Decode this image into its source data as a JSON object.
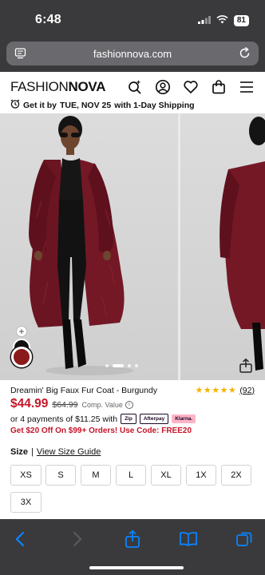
{
  "status": {
    "time": "6:48",
    "battery": "81"
  },
  "browser": {
    "url": "fashionnova.com"
  },
  "header": {
    "logo_part1": "FASHION",
    "logo_part2": "NOVA",
    "shipping_prefix": "Get it by",
    "shipping_date": "TUE, NOV 25",
    "shipping_suffix": "with 1-Day Shipping"
  },
  "gallery": {
    "swatch_add": "+",
    "active_slide": 2,
    "slide_count": 4
  },
  "product": {
    "title": "Dreamin' Big Faux Fur Coat - Burgundy",
    "stars": "★★★★★",
    "review_count": "(92)",
    "price": "$44.99",
    "compare_price": "$64.99",
    "compare_label": "Comp. Value",
    "payments_text": "or 4 payments of $11.25 with",
    "pay_badges": [
      "Zip",
      "Afterpay",
      "Klarna."
    ],
    "promo": "Get $20 Off On $99+ Orders! Use Code: FREE20",
    "size_label": "Size",
    "size_sep": "|",
    "size_guide": "View Size Guide",
    "sizes": [
      "XS",
      "S",
      "M",
      "L",
      "XL",
      "1X",
      "2X",
      "3X"
    ]
  },
  "colors": {
    "price_red": "#c4162a",
    "swatch_burgundy": "#8b1a1a",
    "star": "#f4b400",
    "toolbar_blue": "#0a84ff"
  }
}
